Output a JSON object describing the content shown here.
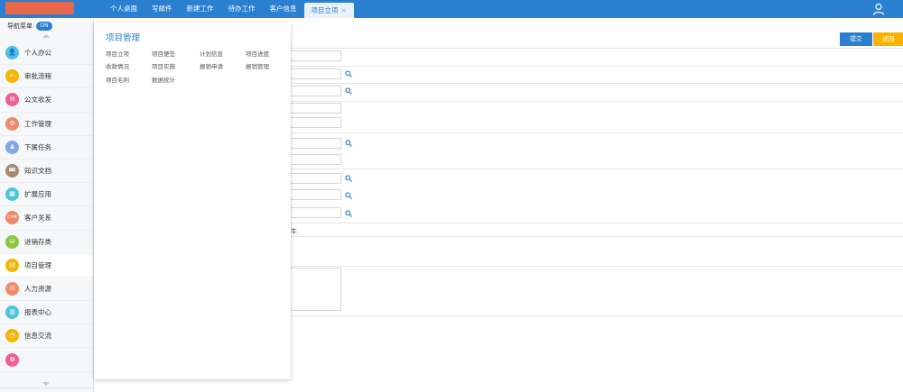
{
  "topbar": {
    "tabs": [
      {
        "label": "个人桌面"
      },
      {
        "label": "写邮件"
      },
      {
        "label": "新建工作"
      },
      {
        "label": "待办工作"
      },
      {
        "label": "客户信息"
      },
      {
        "label": "项目立项"
      }
    ],
    "active_tab_close": "×"
  },
  "sidebar": {
    "nav_toggle_label": "导航菜单",
    "nav_toggle_state": "ON",
    "items": [
      {
        "label": "个人办公",
        "icon": "person-icon",
        "color": "#4fc3dc",
        "glyph": "👤"
      },
      {
        "label": "审批流程",
        "icon": "approval-icon",
        "color": "#f7b500",
        "glyph": "✍"
      },
      {
        "label": "公文收发",
        "icon": "document-icon",
        "color": "#ef5f93",
        "glyph": "✉"
      },
      {
        "label": "工作管理",
        "icon": "work-icon",
        "color": "#ef8a6b",
        "glyph": "⚙"
      },
      {
        "label": "下属任务",
        "icon": "team-icon",
        "color": "#7fa6e8",
        "glyph": "♟"
      },
      {
        "label": "知识文档",
        "icon": "knowledge-icon",
        "color": "#a68a73",
        "glyph": "📖"
      },
      {
        "label": "扩展应用",
        "icon": "extension-icon",
        "color": "#4fc3dc",
        "glyph": "▦"
      },
      {
        "label": "客户关系",
        "icon": "crm-icon",
        "color": "#ef8a6b",
        "glyph": "CRM"
      },
      {
        "label": "进销存类",
        "icon": "inventory-icon",
        "color": "#8cc63f",
        "glyph": "⛁"
      },
      {
        "label": "项目管理",
        "icon": "project-icon",
        "color": "#f7b500",
        "glyph": "▤"
      },
      {
        "label": "人力资源",
        "icon": "hr-icon",
        "color": "#ef8a6b",
        "glyph": "☷"
      },
      {
        "label": "报表中心",
        "icon": "report-icon",
        "color": "#4fc3dc",
        "glyph": "▥"
      },
      {
        "label": "信息交流",
        "icon": "chat-icon",
        "color": "#f7b500",
        "glyph": "◔"
      },
      {
        "label": "",
        "icon": "system-icon",
        "color": "#ef5f93",
        "glyph": "✿"
      }
    ]
  },
  "form": {
    "submit_label": "提交",
    "back_label": "返回",
    "fragment_text": "牛"
  },
  "popup": {
    "title": "项目管理",
    "items": [
      {
        "label": "项目立项"
      },
      {
        "label": "项目便签"
      },
      {
        "label": "计划信息"
      },
      {
        "label": "项目进度"
      },
      {
        "label": "收款情况"
      },
      {
        "label": "项目实施"
      },
      {
        "label": "报销申请"
      },
      {
        "label": "报销管理"
      },
      {
        "label": "项目毛利"
      },
      {
        "label": "数据统计"
      }
    ]
  }
}
